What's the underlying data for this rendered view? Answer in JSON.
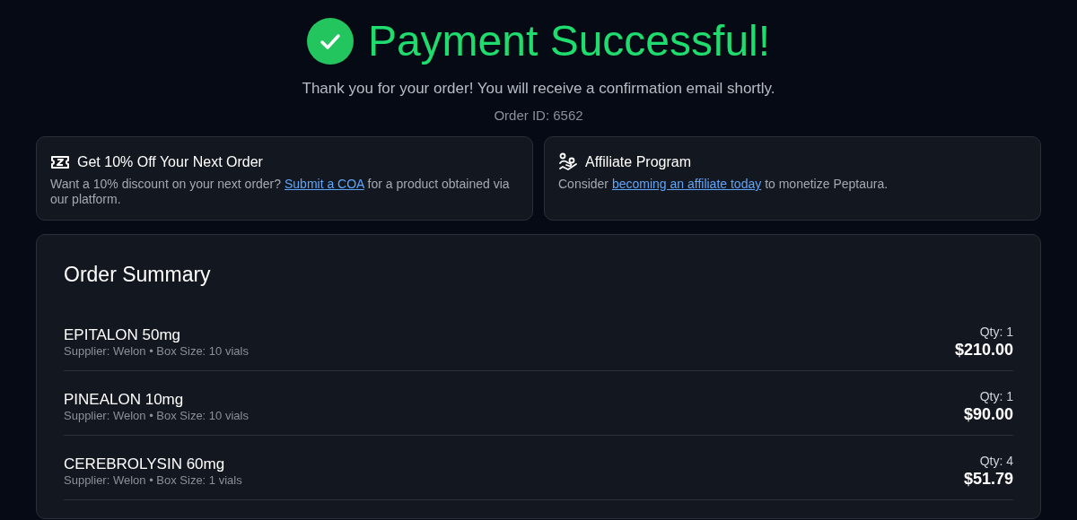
{
  "header": {
    "title": "Payment Successful!",
    "message": "Thank you for your order! You will receive a confirmation email shortly.",
    "order_id": "Order ID: 6562"
  },
  "promos": [
    {
      "kind": "coupon",
      "title": "Get 10% Off Your Next Order",
      "text_before": "Want a 10% discount on your next order?",
      "link": "Submit a COA",
      "text_after": "for a product obtained via our platform."
    },
    {
      "kind": "affiliate",
      "title": "Affiliate Program",
      "text_before": "Consider",
      "link": "becoming an affiliate today",
      "text_after": "to monetize Peptaura."
    }
  ],
  "order_summary": {
    "title": "Order Summary",
    "items": [
      {
        "name": "EPITALON 50mg",
        "details": "Supplier: Welon • Box Size: 10 vials",
        "qty": "Qty: 1",
        "price": "$210.00"
      },
      {
        "name": "PINEALON 10mg",
        "details": "Supplier: Welon • Box Size: 10 vials",
        "qty": "Qty: 1",
        "price": "$90.00"
      },
      {
        "name": "CEREBROLYSIN 60mg",
        "details": "Supplier: Welon • Box Size: 1 vials",
        "qty": "Qty: 4",
        "price": "$51.79"
      }
    ]
  }
}
